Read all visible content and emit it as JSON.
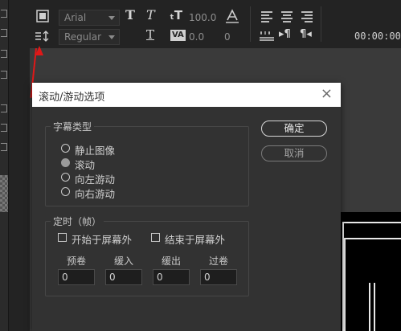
{
  "toolbar": {
    "font_family": "Arial",
    "font_style": "Regular",
    "font_size": "100.0",
    "tracking": "0.0",
    "baseline": "0",
    "timecode": "00:00:00:00",
    "icons": [
      "roll-crawl-options-icon",
      "tab-stops-icon",
      "bold-T-icon",
      "italic-T-icon",
      "underline-T-icon",
      "font-size-icon",
      "kerning-icon",
      "baseline-icon",
      "align-left-icon",
      "align-center-icon",
      "align-right-icon",
      "tab-stops-alt-icon",
      "paragraph-rtl-icon",
      "paragraph-ltr-icon"
    ]
  },
  "annotation": {
    "arrow_color": "#e01818"
  },
  "dialog": {
    "title": "滚动/游动选项",
    "close_label": "×",
    "title_type": {
      "legend": "字幕类型",
      "options": [
        {
          "label": "静止图像",
          "selected": false
        },
        {
          "label": "滚动",
          "selected": true
        },
        {
          "label": "向左游动",
          "selected": false
        },
        {
          "label": "向右游动",
          "selected": false
        }
      ]
    },
    "timing": {
      "legend": "定时（帧）",
      "start_offscreen": "开始于屏幕外",
      "end_offscreen": "结束于屏幕外",
      "columns": [
        {
          "label": "预卷",
          "value": "0"
        },
        {
          "label": "缓入",
          "value": "0"
        },
        {
          "label": "缓出",
          "value": "0"
        },
        {
          "label": "过卷",
          "value": "0"
        }
      ]
    },
    "ok_label": "确定",
    "cancel_label": "取消"
  },
  "colors": {
    "dialog_bg": "#323232",
    "title_bg": "#ffffff",
    "canvas_bg": "#3a3a3a"
  }
}
